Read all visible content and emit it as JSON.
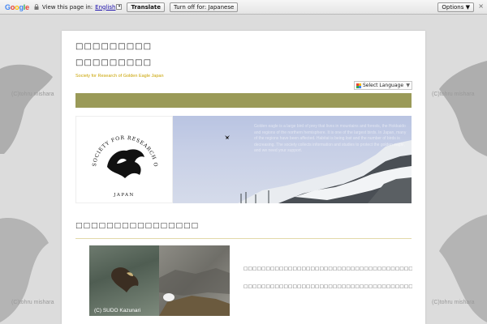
{
  "translate_bar": {
    "google_letters": [
      "G",
      "o",
      "o",
      "g",
      "l",
      "e"
    ],
    "prompt": "View this page in:",
    "language_link": "English",
    "language_caret": "▾",
    "translate_button": "Translate",
    "turn_off_button": "Turn off for: Japanese",
    "options_button": "Options ▼",
    "close_symbol": "×"
  },
  "background": {
    "watermark": "(C)tohru mishara"
  },
  "header": {
    "title_line1": "□□□□□□□□□",
    "title_line2": "□□□□□□□□□",
    "subtitle": "Society for Research of Golden Eagle Japan",
    "language_selector": "Select Language",
    "language_selector_caret": "▼"
  },
  "banner": {
    "logo_text_top": "SOCIETY FOR RESEARCH OF GOLDEN EAGLE",
    "logo_text_bottom": "JAPAN",
    "overlay_text": "Golden eagle is a large bird of prey that lives in mountains and forests, the Hokkaido and regions of the northern hemisphere. It is one of the largest birds. In Japan, many of the regions have been affected. Habitat is being lost and the number of birds is decreasing. The society collects information and studies to protect the golden eagle, and we need your support."
  },
  "section": {
    "heading": "□□□□□□□□□□□□□□□□",
    "photo_credit": "(C) SUDO Kazunari",
    "paragraph1": "□□□□□□□□□□□□□□□□□□□□□□□□□□□□□□□□□□□□□□□□□□□□□□□□□□□□",
    "paragraph2": "□□□□□□□□□□□□□□□□□□□□□□□□□□□□□□□□□□□□□□□□□□□□□□□□□□"
  },
  "colors": {
    "band": "#9a9a58",
    "subtitle": "#c9a300",
    "page_bg": "#dcdcdc"
  }
}
